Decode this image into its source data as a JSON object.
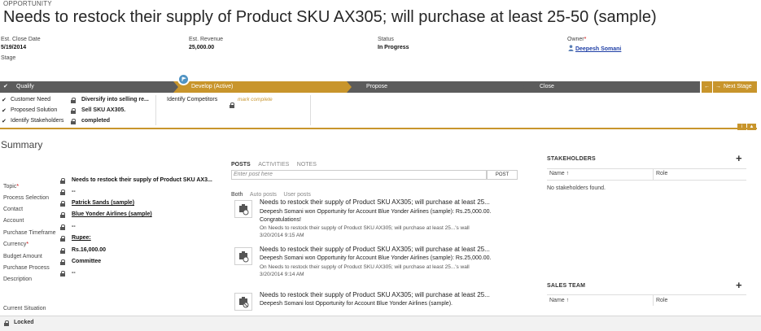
{
  "header": {
    "entity_type": "OPPORTUNITY",
    "title": "Needs to restock their supply of Product SKU AX305; will purchase at least 25-50 (sample)",
    "fields": {
      "close_date_label": "Est. Close Date",
      "close_date": "5/19/2014",
      "stage_label": "Stage",
      "revenue_label": "Est. Revenue",
      "revenue": "25,000.00",
      "status_label": "Status",
      "status": "In Progress",
      "owner_label": "Owner",
      "owner": "Deepesh Somani"
    }
  },
  "process": {
    "stages": [
      "Qualify",
      "Develop (Active)",
      "Propose",
      "Close"
    ],
    "next_stage": "Next Stage",
    "steps_left": [
      {
        "label": "Customer Need",
        "value": "Diversify into selling re..."
      },
      {
        "label": "Proposed Solution",
        "value": "Sell SKU AX305."
      },
      {
        "label": "Identify Stakeholders",
        "value": "completed"
      }
    ],
    "step_mid": {
      "label": "Identify Competitors",
      "value": "mark complete"
    },
    "info_badge": "i"
  },
  "summary": {
    "title": "Summary",
    "fields": [
      {
        "label": "Topic",
        "value": "Needs to restock their supply of Product SKU AX3..."
      },
      {
        "label": "Process Selection",
        "value": "--"
      },
      {
        "label": "Contact",
        "value": "Patrick Sands (sample)"
      },
      {
        "label": "Account",
        "value": "Blue Yonder Airlines (sample)"
      },
      {
        "label": "Purchase Timeframe",
        "value": "--"
      },
      {
        "label": "Currency",
        "value": "Rupee:"
      },
      {
        "label": "Budget Amount",
        "value": "Rs.16,000.00"
      },
      {
        "label": "Purchase Process",
        "value": "Committee"
      },
      {
        "label": "Description",
        "value": "--"
      }
    ],
    "current_situation": "Current Situation"
  },
  "posts": {
    "tabs": [
      "POSTS",
      "ACTIVITIES",
      "NOTES"
    ],
    "input_placeholder": "Enter post here",
    "post_button": "POST",
    "filters": [
      "Both",
      "Auto posts",
      "User posts"
    ],
    "items": [
      {
        "title": "Needs to restock their supply of Product SKU AX305; will purchase at least 25...",
        "text": "Deepesh Somani won Opportunity for Account Blue Yonder Airlines (sample): Rs.25,000.00. Congratulations!",
        "meta": "On Needs to restock their supply of Product SKU AX305; will purchase at least 25...'s wall",
        "time": "3/20/2014 9:15 AM"
      },
      {
        "title": "Needs to restock their supply of Product SKU AX305; will purchase at least 25...",
        "text": "Deepesh Somani won Opportunity for Account Blue Yonder Airlines (sample): Rs.25,000.00.",
        "meta": "On Needs to restock their supply of Product SKU AX305; will purchase at least 25...'s wall",
        "time": "3/20/2014 9:14 AM"
      },
      {
        "title": "Needs to restock their supply of Product SKU AX305; will purchase at least 25...",
        "text": "Deepesh Somani lost Opportunity for Account Blue Yonder Airlines (sample)."
      }
    ]
  },
  "stakeholders": {
    "title": "STAKEHOLDERS",
    "col_name": "Name",
    "col_role": "Role",
    "empty": "No stakeholders found."
  },
  "sales_team": {
    "title": "SALES TEAM",
    "col_name": "Name",
    "col_role": "Role"
  },
  "statusbar": {
    "text": "Locked"
  },
  "colors": {
    "accent": "#c8952c",
    "stage_dark": "#5c5c5c",
    "link": "#1f3fa6"
  }
}
